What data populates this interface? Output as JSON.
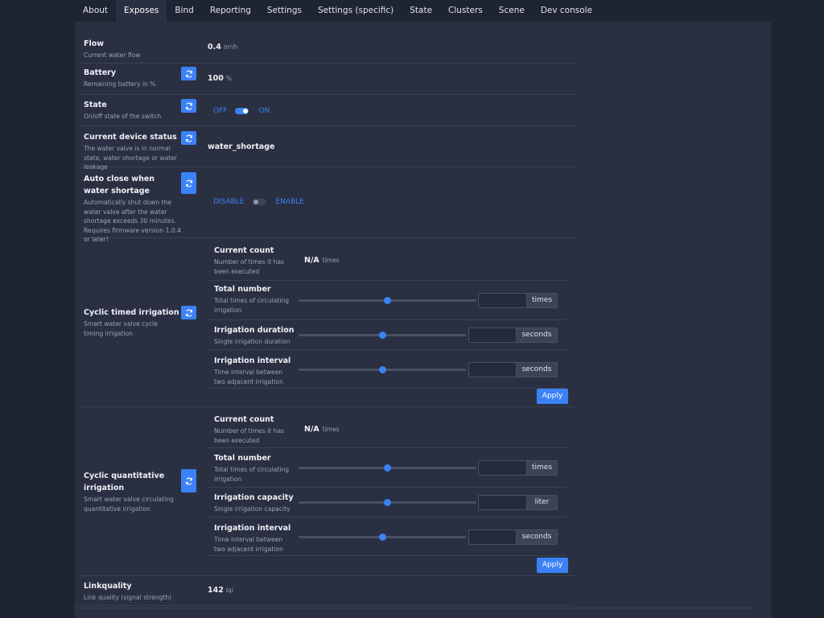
{
  "tabs": [
    "About",
    "Exposes",
    "Bind",
    "Reporting",
    "Settings",
    "Settings (specific)",
    "State",
    "Clusters",
    "Scene",
    "Dev console"
  ],
  "active_tab": 1,
  "flow": {
    "name": "Flow",
    "desc": "Current water flow",
    "value": "0.4",
    "unit": "m³/h"
  },
  "battery": {
    "name": "Battery",
    "desc": "Remaining battery in %",
    "value": "100",
    "unit": "%"
  },
  "state": {
    "name": "State",
    "desc": "On/off state of the switch",
    "off_label": "OFF",
    "on_label": "ON",
    "checked": true
  },
  "device_status": {
    "name": "Current device status",
    "desc": "The water valve is in normal state, water shortage or water leakage",
    "value": "water_shortage"
  },
  "auto_close": {
    "name": "Auto close when water shortage",
    "desc": "Automatically shut down the water valve after the water shortage exceeds 30 minutes. Requires firmware version 1.0.4 or later!",
    "off_label": "DISABLE",
    "on_label": "ENABLE",
    "checked": false
  },
  "cyclic_timed": {
    "name": "Cyclic timed irrigation",
    "desc": "Smart water valve cycle timing irrigation",
    "current_count": {
      "name": "Current count",
      "desc": "Number of times it has been executed",
      "value": "N/A",
      "unit": "times"
    },
    "total_number": {
      "name": "Total number",
      "desc": "Total times of circulating irrigation",
      "unit": "times",
      "level": 0.5,
      "value": ""
    },
    "duration": {
      "name": "Irrigation duration",
      "desc": "Single irrigation duration",
      "unit": "seconds",
      "level": 0.5,
      "value": ""
    },
    "interval": {
      "name": "Irrigation interval",
      "desc": "Time interval between two adjacent irrigation",
      "unit": "seconds",
      "level": 0.5,
      "value": ""
    },
    "apply_label": "Apply"
  },
  "cyclic_quant": {
    "name": "Cyclic quantitative irrigation",
    "desc": "Smart water valve circulating quantitative irrigation",
    "current_count": {
      "name": "Current count",
      "desc": "Number of times it has been executed",
      "value": "N/A",
      "unit": "times"
    },
    "total_number": {
      "name": "Total number",
      "desc": "Total times of circulating irrigation",
      "unit": "times",
      "level": 0.5,
      "value": ""
    },
    "capacity": {
      "name": "Irrigation capacity",
      "desc": "Single irrigation capacity",
      "unit": "liter",
      "level": 0.5,
      "value": ""
    },
    "interval": {
      "name": "Irrigation interval",
      "desc": "Time interval between two adjacent irrigation",
      "unit": "seconds",
      "level": 0.5,
      "value": ""
    },
    "apply_label": "Apply"
  },
  "linkquality": {
    "name": "Linkquality",
    "desc": "Link quality (signal strength)",
    "value": "142",
    "unit": "lqi"
  }
}
